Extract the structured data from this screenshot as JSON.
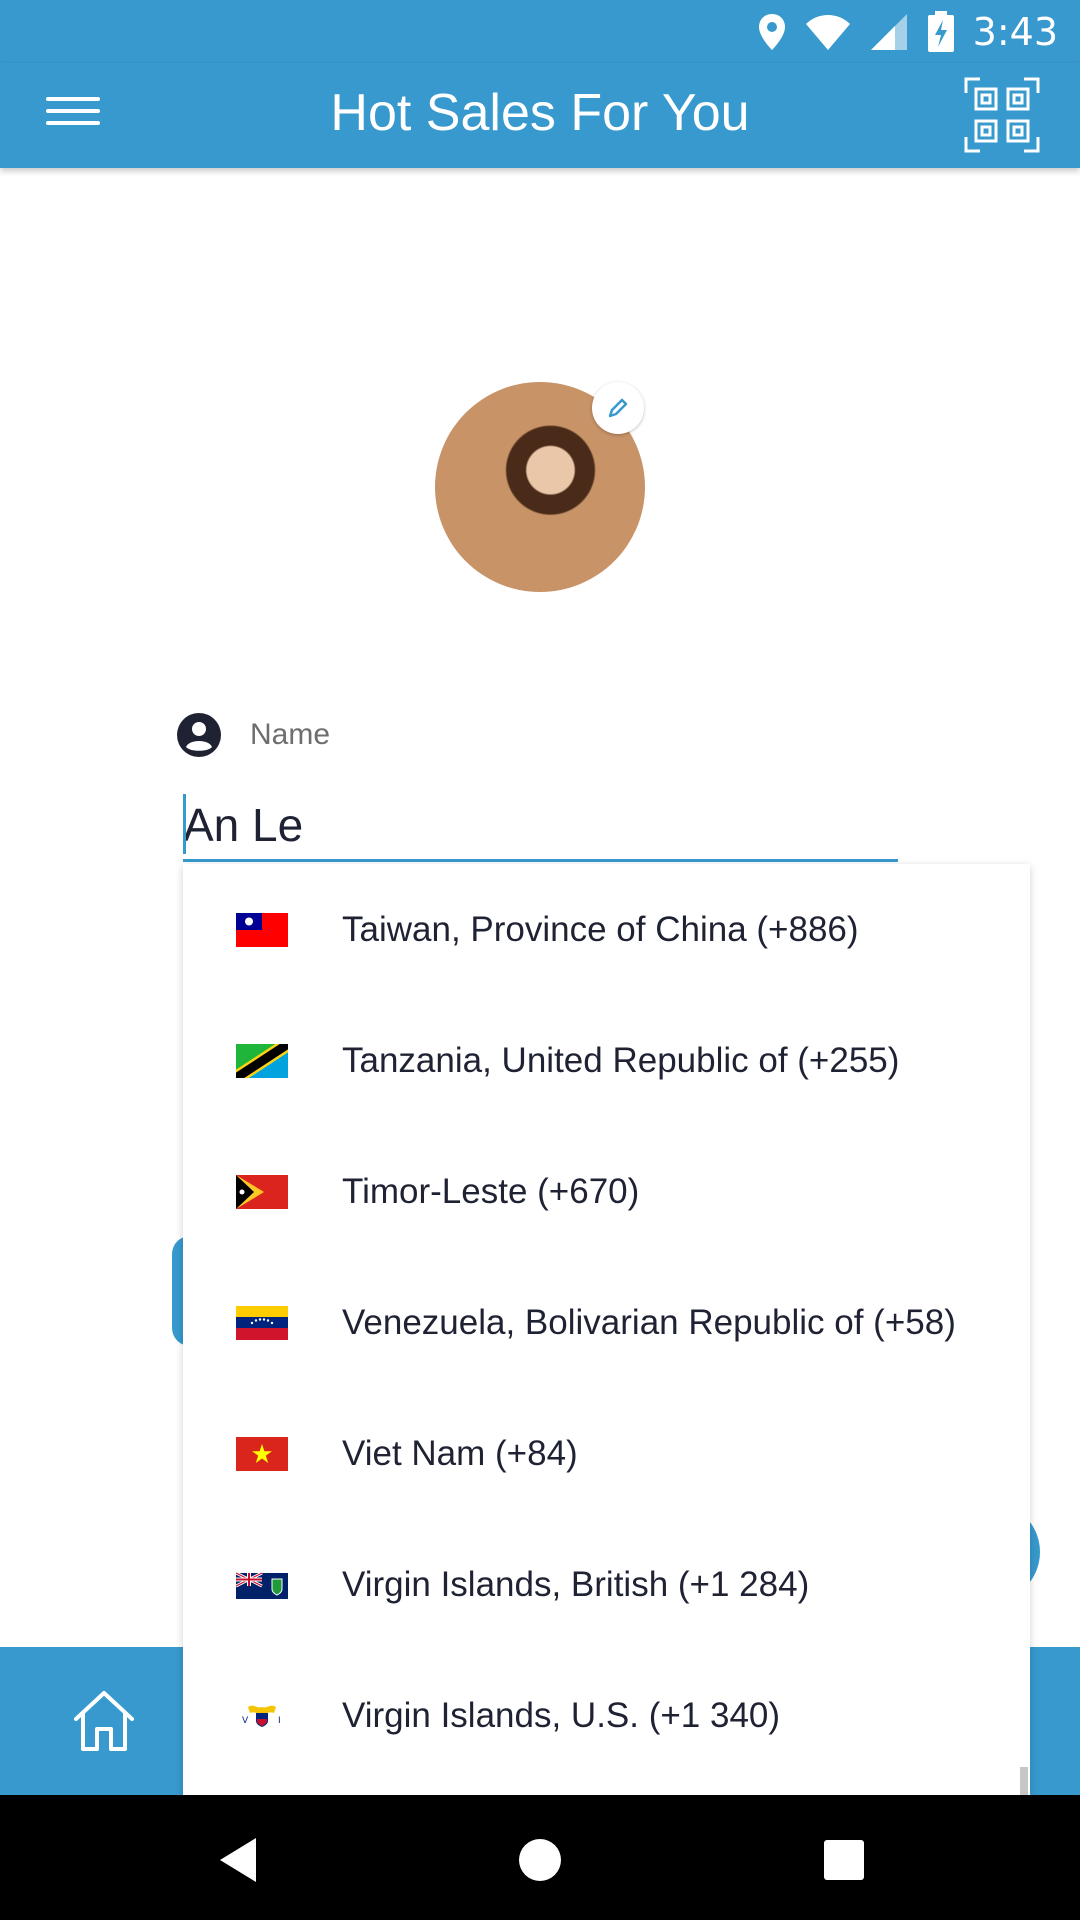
{
  "status_bar": {
    "time": "3:43"
  },
  "app_bar": {
    "title": "Hot Sales For You"
  },
  "profile": {
    "name_label": "Name",
    "name_value": "An Le"
  },
  "country_list": [
    {
      "label": "Taiwan, Province of China (+886)",
      "flag": "taiwan-flag"
    },
    {
      "label": "Tanzania, United Republic of (+255)",
      "flag": "tanzania-flag"
    },
    {
      "label": "Timor-Leste (+670)",
      "flag": "timor-leste-flag"
    },
    {
      "label": "Venezuela, Bolivarian Republic of (+58)",
      "flag": "venezuela-flag"
    },
    {
      "label": "Viet Nam (+84)",
      "flag": "vietnam-flag"
    },
    {
      "label": "Virgin Islands, British (+1 284)",
      "flag": "british-virgin-islands-flag"
    },
    {
      "label": "Virgin Islands, U.S. (+1 340)",
      "flag": "us-virgin-islands-flag"
    }
  ],
  "colors": {
    "primary": "#3799cd",
    "text": "#1f2233",
    "label": "#6e6e6e"
  },
  "icons": {
    "status": [
      "location-icon",
      "wifi-icon",
      "signal-icon",
      "battery-charging-icon"
    ],
    "app_bar": [
      "menu-icon",
      "qr-code-icon"
    ],
    "avatar_edit": "pencil-icon",
    "name_field": "account-circle-icon",
    "bottom_nav": "home-icon",
    "system_nav": [
      "back-icon",
      "home-circle-icon",
      "recents-icon"
    ]
  }
}
